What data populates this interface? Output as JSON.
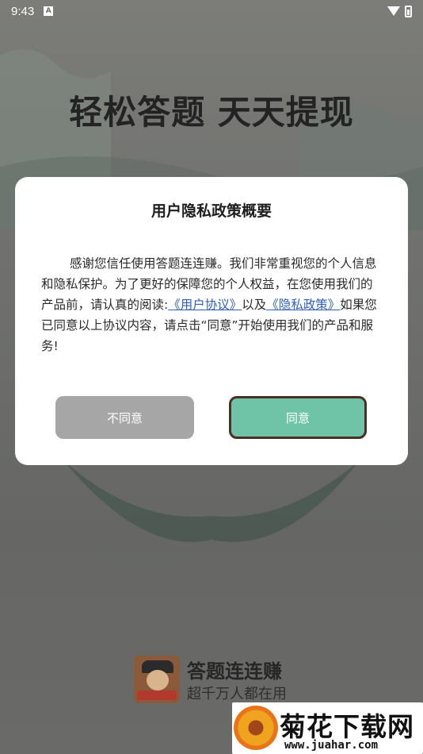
{
  "status_bar": {
    "time": "9:43",
    "notif_letter": "A"
  },
  "background": {
    "headline": "轻松答题 天天提现"
  },
  "dialog": {
    "title": "用户隐私政策概要",
    "body_part1": "感谢您信任使用答题连连赚。我们非常重视您的个人信息和隐私保护。为了更好的保障您的个人权益，在您使用我们的产品前，请认真的阅读:",
    "link_user_agreement": "《用户协议》",
    "body_part2": "以及",
    "link_privacy_policy": "《隐私政策》",
    "body_part3": "如果您已同意以上协议内容，请点击“同意”开始使用我们的产品和服务!",
    "disagree_label": "不同意",
    "agree_label": "同意",
    "colors": {
      "agree": "#6fc3a6",
      "disagree": "#a6a6a6",
      "link": "#2f5fc0"
    }
  },
  "app_branding": {
    "name": "答题连连赚",
    "slogan": "超千万人都在用",
    "logo_top_text": "答题",
    "logo_band_text": "现金天天领"
  },
  "watermark": {
    "title": "菊花下载网",
    "url": "www.juahar.com"
  }
}
